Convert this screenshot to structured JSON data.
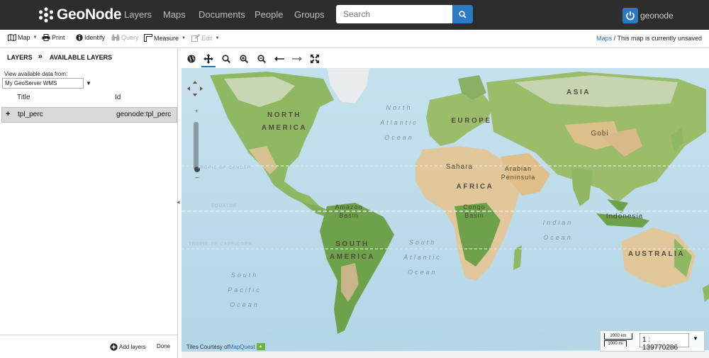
{
  "navbar": {
    "brand": "GeoNode",
    "links": [
      "Layers",
      "Maps",
      "Documents",
      "People",
      "Groups"
    ],
    "search_placeholder": "Search",
    "username": "geonode"
  },
  "toolbar": {
    "map_label": "Map",
    "print_label": "Print",
    "identify_label": "Identify",
    "query_label": "Query",
    "measure_label": "Measure",
    "edit_label": "Edit",
    "breadcrumb_link": "Maps",
    "status_text": "/ This map is currently unsaved"
  },
  "left_panel": {
    "tab_layers": "LAYERS",
    "tab_separator": "»",
    "tab_available": "AVAILABLE LAYERS",
    "source_label": "View available data from:",
    "source_value": "My GeoServer WMS",
    "columns": {
      "title": "Title",
      "id": "Id"
    },
    "rows": [
      {
        "expand": "+",
        "title": "tpl_perc",
        "id": "geonode:tpl_perc"
      }
    ],
    "add_layers_label": "Add layers",
    "done_label": "Done"
  },
  "map": {
    "oceans": {
      "north_atlantic": "North\nAtlantic\nOcean",
      "south_atlantic": "South\nAtlantic\nOcean",
      "south_pacific": "South\nPacific\nOcean",
      "indian": "Indian\nOcean"
    },
    "continents": {
      "north_america": "NORTH\nAMERICA",
      "south_america": "SOUTH\nAMERICA",
      "europe": "EUROPE",
      "asia": "ASIA",
      "africa": "AFRICA",
      "australia": "AUSTRALIA"
    },
    "regions": {
      "sahara": "Sahara",
      "arabian": "Arabian\nPeninsula",
      "gobi": "Gobi",
      "congo": "Congo\nBasin",
      "amazon": "Amazon\nBasin",
      "indonesia": "Indonesia"
    },
    "lines": {
      "cancer": "TROPIC OF CANCER",
      "equator": "EQUATOR",
      "capricorn": "TROPIC OF CAPRICORN"
    },
    "attribution_prefix": "Tiles Courtesy of ",
    "attribution_link": "MapQuest",
    "zoom_plus": "+",
    "zoom_minus": "−",
    "scale_km": "2000 km",
    "scale_mi": "1000 mi",
    "scale_value": "1 : 139770286"
  },
  "colors": {
    "navbar_bg": "#2d2d2d",
    "accent": "#2a7bc4",
    "ocean": "#b9dbe8",
    "land_green": "#8fb862",
    "desert": "#e2c79a"
  }
}
